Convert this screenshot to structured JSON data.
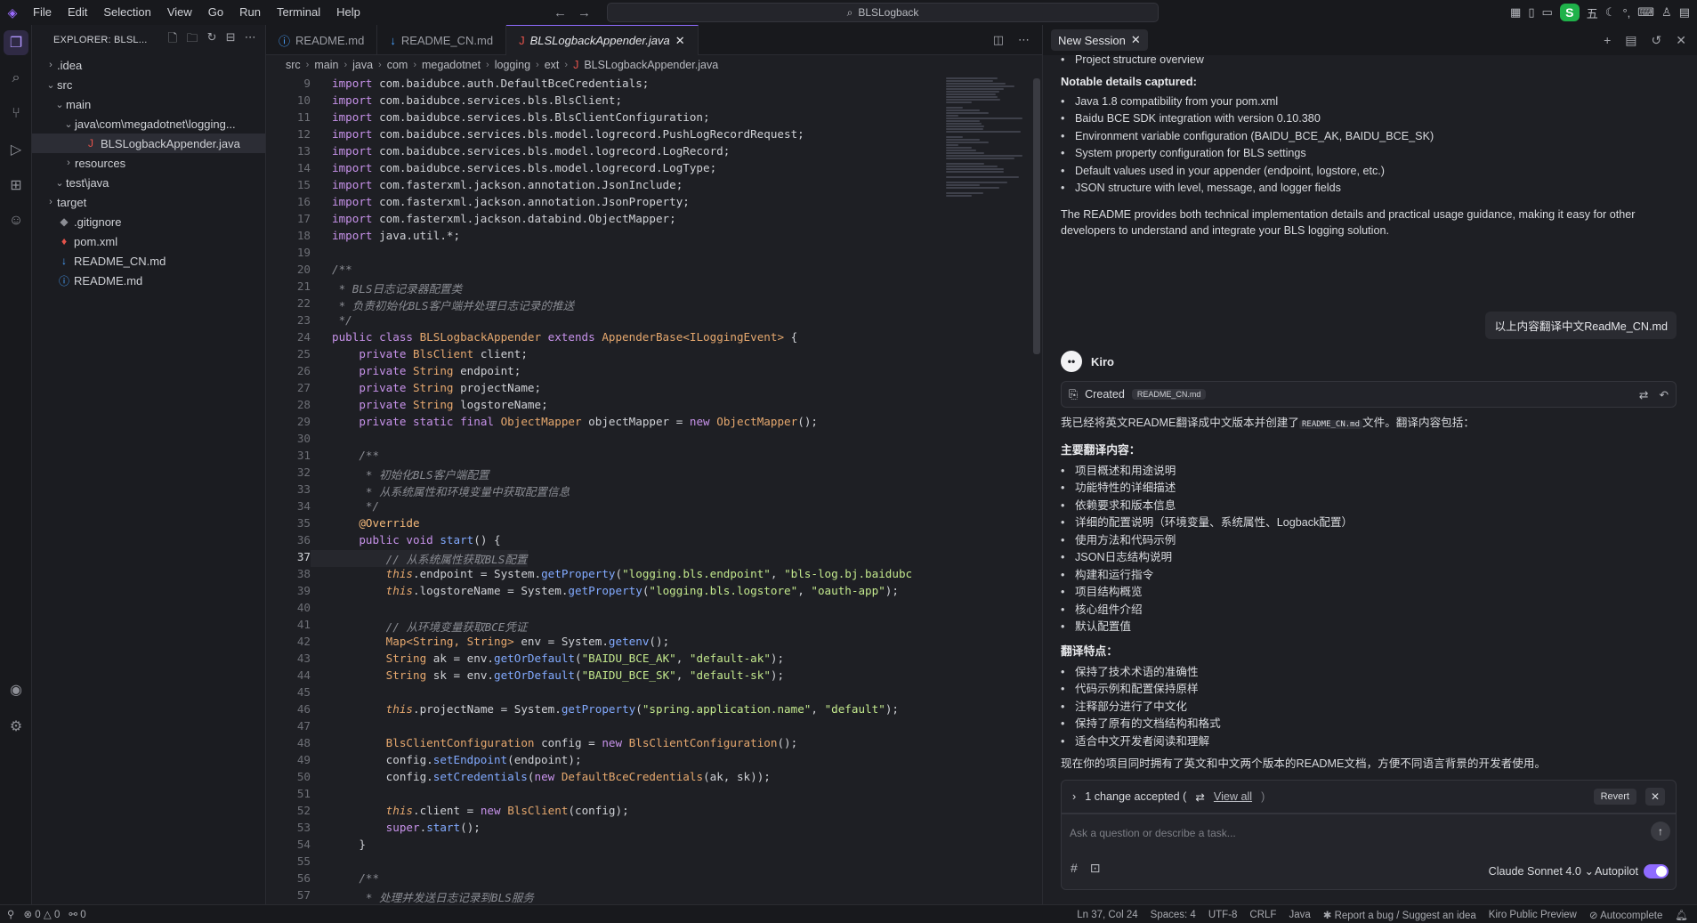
{
  "menu": [
    "File",
    "Edit",
    "Selection",
    "View",
    "Go",
    "Run",
    "Terminal",
    "Help"
  ],
  "window_title": "BLSLogback",
  "ime_tray": [
    "五"
  ],
  "sidebar": {
    "header": "EXPLORER: BLSL...",
    "items": [
      {
        "label": ".idea",
        "indent": 0,
        "type": "folder",
        "open": false
      },
      {
        "label": "src",
        "indent": 0,
        "type": "folder",
        "open": true
      },
      {
        "label": "main",
        "indent": 1,
        "type": "folder",
        "open": true
      },
      {
        "label": "java\\com\\megadotnet\\logging...",
        "indent": 2,
        "type": "folder",
        "open": true
      },
      {
        "label": "BLSLogbackAppender.java",
        "indent": 3,
        "type": "java",
        "open": false
      },
      {
        "label": "resources",
        "indent": 2,
        "type": "folder",
        "open": false
      },
      {
        "label": "test\\java",
        "indent": 1,
        "type": "folder",
        "open": true
      },
      {
        "label": "target",
        "indent": 0,
        "type": "folder",
        "open": false
      },
      {
        "label": ".gitignore",
        "indent": 0,
        "type": "git",
        "open": false
      },
      {
        "label": "pom.xml",
        "indent": 0,
        "type": "xml",
        "open": false
      },
      {
        "label": "README_CN.md",
        "indent": 0,
        "type": "md-blue",
        "open": false
      },
      {
        "label": "README.md",
        "indent": 0,
        "type": "info",
        "open": false
      }
    ]
  },
  "editor": {
    "tabs": [
      {
        "label": "README.md",
        "active": false
      },
      {
        "label": "README_CN.md",
        "active": false
      },
      {
        "label": "BLSLogbackAppender.java",
        "active": true
      }
    ],
    "breadcrumb": [
      "src",
      "main",
      "java",
      "com",
      "megadotnet",
      "logging",
      "ext",
      "BLSLogbackAppender.java"
    ],
    "current_line": 37,
    "lines": [
      {
        "n": 9,
        "t": [
          [
            "kw",
            "import "
          ],
          [
            "",
            "com.baidubce.auth.DefaultBceCredentials;"
          ]
        ]
      },
      {
        "n": 10,
        "t": [
          [
            "kw",
            "import "
          ],
          [
            "",
            "com.baidubce.services.bls.BlsClient;"
          ]
        ]
      },
      {
        "n": 11,
        "t": [
          [
            "kw",
            "import "
          ],
          [
            "",
            "com.baidubce.services.bls.BlsClientConfiguration;"
          ]
        ]
      },
      {
        "n": 12,
        "t": [
          [
            "kw",
            "import "
          ],
          [
            "",
            "com.baidubce.services.bls.model.logrecord.PushLogRecordRequest;"
          ]
        ]
      },
      {
        "n": 13,
        "t": [
          [
            "kw",
            "import "
          ],
          [
            "",
            "com.baidubce.services.bls.model.logrecord.LogRecord;"
          ]
        ]
      },
      {
        "n": 14,
        "t": [
          [
            "kw",
            "import "
          ],
          [
            "",
            "com.baidubce.services.bls.model.logrecord.LogType;"
          ]
        ]
      },
      {
        "n": 15,
        "t": [
          [
            "kw",
            "import "
          ],
          [
            "",
            "com.fasterxml.jackson.annotation.JsonInclude;"
          ]
        ]
      },
      {
        "n": 16,
        "t": [
          [
            "kw",
            "import "
          ],
          [
            "",
            "com.fasterxml.jackson.annotation.JsonProperty;"
          ]
        ]
      },
      {
        "n": 17,
        "t": [
          [
            "kw",
            "import "
          ],
          [
            "",
            "com.fasterxml.jackson.databind.ObjectMapper;"
          ]
        ]
      },
      {
        "n": 18,
        "t": [
          [
            "kw",
            "import "
          ],
          [
            "",
            "java.util.*;"
          ]
        ]
      },
      {
        "n": 19,
        "t": []
      },
      {
        "n": 20,
        "t": [
          [
            "cm",
            "/**"
          ]
        ]
      },
      {
        "n": 21,
        "t": [
          [
            "cm",
            " * BLS日志记录器配置类"
          ]
        ]
      },
      {
        "n": 22,
        "t": [
          [
            "cm",
            " * 负责初始化BLS客户端并处理日志记录的推送"
          ]
        ]
      },
      {
        "n": 23,
        "t": [
          [
            "cm",
            " */"
          ]
        ]
      },
      {
        "n": 24,
        "t": [
          [
            "kw",
            "public class "
          ],
          [
            "ty",
            "BLSLogbackAppender "
          ],
          [
            "kw",
            "extends "
          ],
          [
            "ty",
            "AppenderBase<ILoggingEvent>"
          ],
          [
            "",
            " {"
          ]
        ]
      },
      {
        "n": 25,
        "t": [
          [
            "",
            "    "
          ],
          [
            "kw",
            "private "
          ],
          [
            "ty",
            "BlsClient "
          ],
          [
            "",
            "client;"
          ]
        ]
      },
      {
        "n": 26,
        "t": [
          [
            "",
            "    "
          ],
          [
            "kw",
            "private "
          ],
          [
            "ty",
            "String "
          ],
          [
            "",
            "endpoint;"
          ]
        ]
      },
      {
        "n": 27,
        "t": [
          [
            "",
            "    "
          ],
          [
            "kw",
            "private "
          ],
          [
            "ty",
            "String "
          ],
          [
            "",
            "projectName;"
          ]
        ]
      },
      {
        "n": 28,
        "t": [
          [
            "",
            "    "
          ],
          [
            "kw",
            "private "
          ],
          [
            "ty",
            "String "
          ],
          [
            "",
            "logstoreName;"
          ]
        ]
      },
      {
        "n": 29,
        "t": [
          [
            "",
            "    "
          ],
          [
            "kw",
            "private static final "
          ],
          [
            "ty",
            "ObjectMapper "
          ],
          [
            "",
            "objectMapper = "
          ],
          [
            "kw",
            "new "
          ],
          [
            "ty",
            "ObjectMapper"
          ],
          [
            "",
            "();"
          ]
        ]
      },
      {
        "n": 30,
        "t": []
      },
      {
        "n": 31,
        "t": [
          [
            "cm",
            "    /**"
          ]
        ]
      },
      {
        "n": 32,
        "t": [
          [
            "cm",
            "     * 初始化BLS客户端配置"
          ]
        ]
      },
      {
        "n": 33,
        "t": [
          [
            "cm",
            "     * 从系统属性和环境变量中获取配置信息"
          ]
        ]
      },
      {
        "n": 34,
        "t": [
          [
            "cm",
            "     */"
          ]
        ]
      },
      {
        "n": 35,
        "t": [
          [
            "",
            "    "
          ],
          [
            "an",
            "@Override"
          ]
        ]
      },
      {
        "n": 36,
        "t": [
          [
            "",
            "    "
          ],
          [
            "kw",
            "public void "
          ],
          [
            "fn",
            "start"
          ],
          [
            "",
            "() {"
          ]
        ]
      },
      {
        "n": 37,
        "t": [
          [
            "",
            "        "
          ],
          [
            "cm",
            "// 从系统属性获取BLS配置"
          ]
        ]
      },
      {
        "n": 38,
        "t": [
          [
            "",
            "        "
          ],
          [
            "th",
            "this"
          ],
          [
            "",
            ".endpoint = System."
          ],
          [
            "fn",
            "getProperty"
          ],
          [
            "",
            "("
          ],
          [
            "str",
            "\"logging.bls.endpoint\""
          ],
          [
            "",
            ", "
          ],
          [
            "str",
            "\"bls-log.bj.baidubc"
          ]
        ]
      },
      {
        "n": 39,
        "t": [
          [
            "",
            "        "
          ],
          [
            "th",
            "this"
          ],
          [
            "",
            ".logstoreName = System."
          ],
          [
            "fn",
            "getProperty"
          ],
          [
            "",
            "("
          ],
          [
            "str",
            "\"logging.bls.logstore\""
          ],
          [
            "",
            ", "
          ],
          [
            "str",
            "\"oauth-app\""
          ],
          [
            "",
            ");"
          ]
        ]
      },
      {
        "n": 40,
        "t": []
      },
      {
        "n": 41,
        "t": [
          [
            "",
            "        "
          ],
          [
            "cm",
            "// 从环境变量获取BCE凭证"
          ]
        ]
      },
      {
        "n": 42,
        "t": [
          [
            "",
            "        "
          ],
          [
            "ty",
            "Map<String, String> "
          ],
          [
            "",
            "env = System."
          ],
          [
            "fn",
            "getenv"
          ],
          [
            "",
            "();"
          ]
        ]
      },
      {
        "n": 43,
        "t": [
          [
            "",
            "        "
          ],
          [
            "ty",
            "String "
          ],
          [
            "",
            "ak = env."
          ],
          [
            "fn",
            "getOrDefault"
          ],
          [
            "",
            "("
          ],
          [
            "str",
            "\"BAIDU_BCE_AK\""
          ],
          [
            "",
            ", "
          ],
          [
            "str",
            "\"default-ak\""
          ],
          [
            "",
            ");"
          ]
        ]
      },
      {
        "n": 44,
        "t": [
          [
            "",
            "        "
          ],
          [
            "ty",
            "String "
          ],
          [
            "",
            "sk = env."
          ],
          [
            "fn",
            "getOrDefault"
          ],
          [
            "",
            "("
          ],
          [
            "str",
            "\"BAIDU_BCE_SK\""
          ],
          [
            "",
            ", "
          ],
          [
            "str",
            "\"default-sk\""
          ],
          [
            "",
            ");"
          ]
        ]
      },
      {
        "n": 45,
        "t": []
      },
      {
        "n": 46,
        "t": [
          [
            "",
            "        "
          ],
          [
            "th",
            "this"
          ],
          [
            "",
            ".projectName = System."
          ],
          [
            "fn",
            "getProperty"
          ],
          [
            "",
            "("
          ],
          [
            "str",
            "\"spring.application.name\""
          ],
          [
            "",
            ", "
          ],
          [
            "str",
            "\"default\""
          ],
          [
            "",
            ");"
          ]
        ]
      },
      {
        "n": 47,
        "t": []
      },
      {
        "n": 48,
        "t": [
          [
            "",
            "        "
          ],
          [
            "ty",
            "BlsClientConfiguration "
          ],
          [
            "",
            "config = "
          ],
          [
            "kw",
            "new "
          ],
          [
            "ty",
            "BlsClientConfiguration"
          ],
          [
            "",
            "();"
          ]
        ]
      },
      {
        "n": 49,
        "t": [
          [
            "",
            "        config."
          ],
          [
            "fn",
            "setEndpoint"
          ],
          [
            "",
            "(endpoint);"
          ]
        ]
      },
      {
        "n": 50,
        "t": [
          [
            "",
            "        config."
          ],
          [
            "fn",
            "setCredentials"
          ],
          [
            "",
            "("
          ],
          [
            "kw",
            "new "
          ],
          [
            "ty",
            "DefaultBceCredentials"
          ],
          [
            "",
            "(ak, sk));"
          ]
        ]
      },
      {
        "n": 51,
        "t": []
      },
      {
        "n": 52,
        "t": [
          [
            "",
            "        "
          ],
          [
            "th",
            "this"
          ],
          [
            "",
            ".client = "
          ],
          [
            "kw",
            "new "
          ],
          [
            "ty",
            "BlsClient"
          ],
          [
            "",
            "(config);"
          ]
        ]
      },
      {
        "n": 53,
        "t": [
          [
            "",
            "        "
          ],
          [
            "kw",
            "super"
          ],
          [
            "",
            "."
          ],
          [
            "fn",
            "start"
          ],
          [
            "",
            "();"
          ]
        ]
      },
      {
        "n": 54,
        "t": [
          [
            "",
            "    }"
          ]
        ]
      },
      {
        "n": 55,
        "t": []
      },
      {
        "n": 56,
        "t": [
          [
            "cm",
            "    /**"
          ]
        ]
      },
      {
        "n": 57,
        "t": [
          [
            "cm",
            "     * 处理并发送日志记录到BLS服务"
          ]
        ]
      }
    ]
  },
  "chat": {
    "tab_label": "New Session",
    "intro_bullet": "Project structure overview",
    "notable_heading": "Notable details captured:",
    "notable_items": [
      "Java 1.8 compatibility from your  pom.xml",
      "Baidu BCE SDK integration with version 0.10.380",
      "Environment variable configuration (BAIDU_BCE_AK, BAIDU_BCE_SK)",
      "System property configuration for BLS settings",
      "Default values used in your appender (endpoint, logstore, etc.)",
      "JSON structure with level, message, and logger fields"
    ],
    "summary_line1": "The README provides both technical implementation details and practical usage guidance, making it easy for other",
    "summary_line2": "developers to understand and integrate your BLS logging solution.",
    "user_message": "以上内容翻译中文ReadMe_CN.md",
    "agent_name": "Kiro",
    "created_label": "Created",
    "created_file": "README_CN.md",
    "reply_intro_pre": "我已经将英文README翻译成中文版本并创建了",
    "reply_intro_file": "README_CN.md",
    "reply_intro_post": "文件。翻译内容包括：",
    "main_heading": "主要翻译内容：",
    "main_items": [
      "项目概述和用途说明",
      "功能特性的详细描述",
      "依赖要求和版本信息",
      "详细的配置说明（环境变量、系统属性、Logback配置）",
      "使用方法和代码示例",
      "JSON日志结构说明",
      "构建和运行指令",
      "项目结构概览",
      "核心组件介绍",
      "默认配置值"
    ],
    "features_heading": "翻译特点：",
    "feature_items": [
      "保持了技术术语的准确性",
      "代码示例和配置保持原样",
      "注释部分进行了中文化",
      "保持了原有的文档结构和格式",
      "适合中文开发者阅读和理解"
    ],
    "closing": "现在你的项目同时拥有了英文和中文两个版本的README文档，方便不同语言背景的开发者使用。",
    "change_accepted": "1 change accepted (",
    "view_all": "View all",
    "change_close_paren": ")",
    "revert_label": "Revert",
    "input_placeholder": "Ask a question or describe a task...",
    "model": "Claude Sonnet 4.0",
    "autopilot_label": "Autopilot"
  },
  "status": {
    "errors": "0",
    "warnings": "0",
    "ports": "0",
    "position": "Ln 37, Col 24",
    "spaces": "Spaces: 4",
    "encoding": "UTF-8",
    "eol": "CRLF",
    "language": "Java",
    "report": "Report a bug / Suggest an idea",
    "preview": "Kiro Public Preview",
    "autocomplete": "Autocomplete"
  }
}
